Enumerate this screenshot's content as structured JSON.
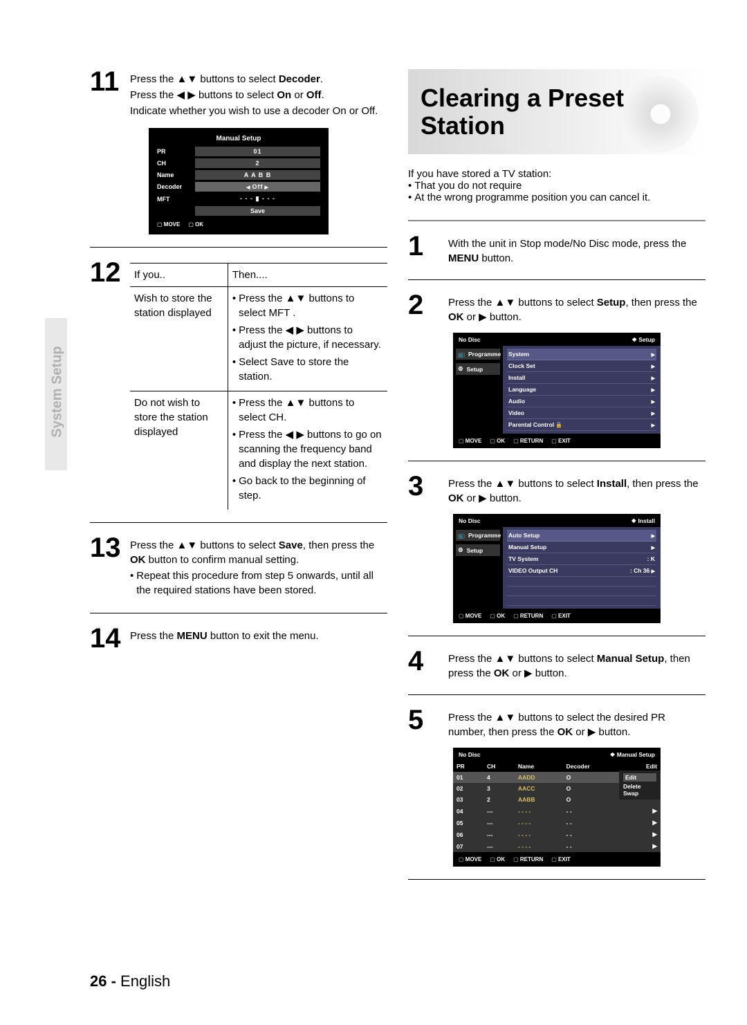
{
  "side_tab": "System Setup",
  "left": {
    "step11": {
      "num": "11",
      "line1a": "Press the ",
      "line1_icon": "▲▼",
      "line1b": " buttons to select ",
      "line1c": "Decoder",
      "line1d": ".",
      "line2a": "Press the ",
      "line2_icon": "◀ ▶",
      "line2b": " buttons to select ",
      "line2c": "On",
      "line2d": " or ",
      "line2e": "Off",
      "line2f": ".",
      "line3": "Indicate whether you wish to use a decoder On or Off."
    },
    "osd1": {
      "title": "Manual Setup",
      "rows": {
        "pr": {
          "label": "PR",
          "val": "01"
        },
        "ch": {
          "label": "CH",
          "val": "2"
        },
        "name": {
          "label": "Name",
          "val": "A A B B"
        },
        "dec": {
          "label": "Decoder",
          "val": "Off"
        },
        "mft": {
          "label": "MFT",
          "val": "- - - ▮ - - -"
        }
      },
      "save": "Save",
      "foot": {
        "move": "MOVE",
        "ok": "OK"
      }
    },
    "step12": {
      "num": "12",
      "head_if": "If you..",
      "head_then": "Then....",
      "r1_if": "Wish to store the station displayed",
      "r1_b1a": "Press the ▲▼ buttons to select MFT .",
      "r1_b2": "Press the ◀ ▶ buttons to adjust the picture, if necessary.",
      "r1_b3": "Select Save to store the station.",
      "r2_if": "Do not wish to store the station displayed",
      "r2_b1": "Press the ▲▼ buttons to select CH.",
      "r2_b2": "Press the ◀ ▶ buttons to go on scanning the frequency band and display the next station.",
      "r2_b3": "Go back to the beginning of step."
    },
    "step13": {
      "num": "13",
      "line1a": "Press the ▲▼ buttons to select ",
      "line1b": "Save",
      "line1c": ", then press the ",
      "line1d": "OK",
      "line1e": " button to confirm manual setting.",
      "bullet": "Repeat this procedure from step 5 onwards, until all the required stations have been stored."
    },
    "step14": {
      "num": "14",
      "line1a": "Press the ",
      "line1b": "MENU",
      "line1c": " button to exit the menu."
    }
  },
  "right": {
    "title": "Clearing a Preset Station",
    "intro": "If you have stored a TV station:",
    "intro_b1": "That you do not require",
    "intro_b2": "At the wrong programme position you can cancel it.",
    "step1": {
      "num": "1",
      "a": "With the unit in Stop mode/No Disc mode, press the ",
      "b": "MENU",
      "c": " button."
    },
    "step2": {
      "num": "2",
      "a": "Press the ▲▼ buttons to select ",
      "b": "Setup",
      "c": ", then press the ",
      "d": "OK",
      "e": " or ▶ button."
    },
    "osd_setup": {
      "nodisc": "No Disc",
      "crumb": "Setup",
      "side": {
        "prog": "Programme",
        "setup": "Setup"
      },
      "items": [
        "System",
        "Clock Set",
        "Install",
        "Language",
        "Audio",
        "Video",
        "Parental Control"
      ],
      "foot": {
        "move": "MOVE",
        "ok": "OK",
        "ret": "RETURN",
        "exit": "EXIT"
      }
    },
    "step3": {
      "num": "3",
      "a": "Press the ▲▼ buttons to select ",
      "b": "Install",
      "c": ", then press the ",
      "d": "OK",
      "e": " or ▶ button."
    },
    "osd_install": {
      "nodisc": "No Disc",
      "crumb": "Install",
      "side": {
        "prog": "Programme",
        "setup": "Setup"
      },
      "rows": [
        {
          "l": "Auto Setup",
          "r": ""
        },
        {
          "l": "Manual Setup",
          "r": ""
        },
        {
          "l": "TV System",
          "r": ": K"
        },
        {
          "l": "VIDEO Output CH",
          "r": ": Ch 36"
        }
      ],
      "foot": {
        "move": "MOVE",
        "ok": "OK",
        "ret": "RETURN",
        "exit": "EXIT"
      }
    },
    "step4": {
      "num": "4",
      "a": "Press the ▲▼ buttons to select ",
      "b": "Manual Setup",
      "c": ", then press the ",
      "d": "OK",
      "e": " or ▶ button."
    },
    "step5": {
      "num": "5",
      "a": "Press the ▲▼ buttons to select the desired PR number, then press the ",
      "b": "OK",
      "c": " or ▶ button."
    },
    "osd_ms": {
      "nodisc": "No Disc",
      "crumb": "Manual Setup",
      "headers": {
        "pr": "PR",
        "ch": "CH",
        "name": "Name",
        "dec": "Decoder",
        "edit": "Edit"
      },
      "rows": [
        {
          "pr": "01",
          "ch": "4",
          "name": "AADD",
          "dec": "O",
          "hl": true,
          "pop": "Edit"
        },
        {
          "pr": "02",
          "ch": "3",
          "name": "AACC",
          "dec": "O",
          "pop": "Delete"
        },
        {
          "pr": "03",
          "ch": "2",
          "name": "AABB",
          "dec": "O",
          "pop": "Swap"
        },
        {
          "pr": "04",
          "ch": "---",
          "name": "- - - -",
          "dec": "- -"
        },
        {
          "pr": "05",
          "ch": "---",
          "name": "- - - -",
          "dec": "- -"
        },
        {
          "pr": "06",
          "ch": "---",
          "name": "- - - -",
          "dec": "- -"
        },
        {
          "pr": "07",
          "ch": "---",
          "name": "- - - -",
          "dec": "- -"
        }
      ],
      "foot": {
        "move": "MOVE",
        "ok": "OK",
        "ret": "RETURN",
        "exit": "EXIT"
      }
    }
  },
  "footer": {
    "page": "26 -",
    "lang": "English"
  }
}
